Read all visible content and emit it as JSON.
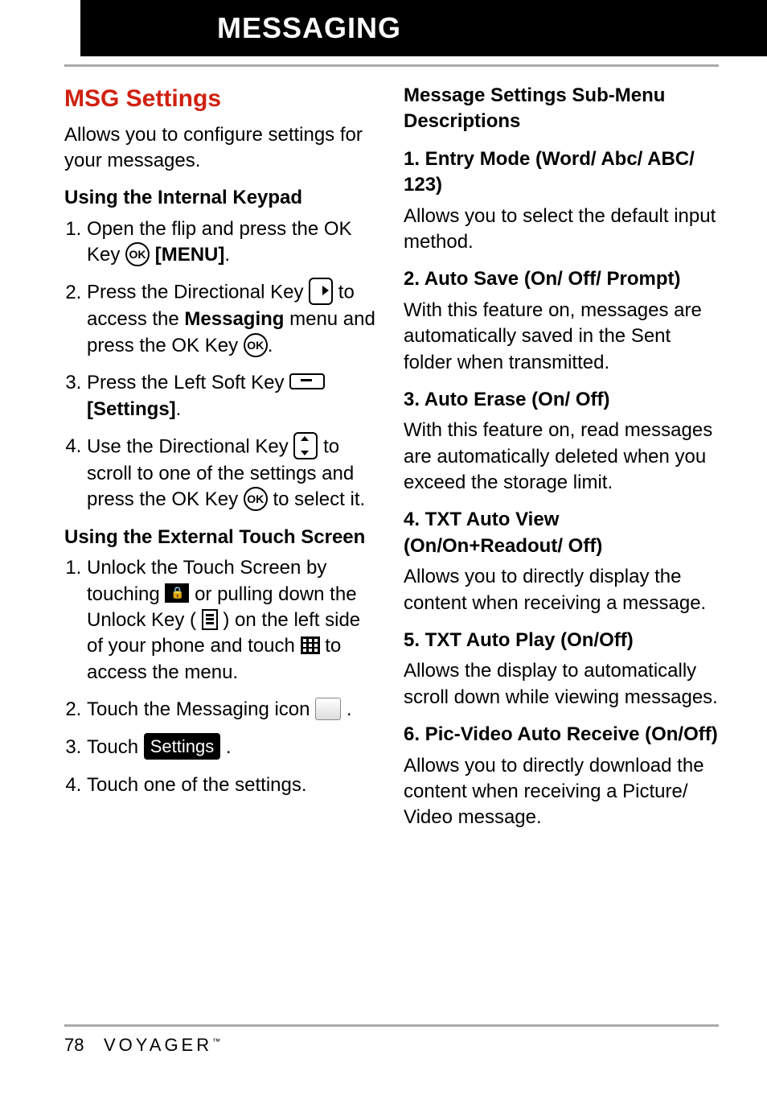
{
  "header": {
    "title": "MESSAGING"
  },
  "left": {
    "section_title": "MSG Settings",
    "intro": "Allows you to configure settings for your messages.",
    "keypad_heading": "Using the Internal Keypad",
    "kp1_a": "Open the flip and press the OK Key ",
    "kp1_b": " [MENU]",
    "kp1_c": ".",
    "kp2_a": "Press the Directional Key ",
    "kp2_b": " to access the ",
    "kp2_c": "Messaging",
    "kp2_d": " menu and press the OK Key ",
    "kp2_e": ".",
    "kp3_a": "Press the Left Soft Key ",
    "kp3_b": " ",
    "kp3_c": "[Settings]",
    "kp3_d": ".",
    "kp4_a": "Use the Directional Key ",
    "kp4_b": " to scroll to one of the settings and press the OK Key ",
    "kp4_c": " to select it.",
    "touch_heading": "Using the External Touch Screen",
    "t1_a": "Unlock the Touch Screen by touching ",
    "t1_b": " or pulling down the Unlock Key ( ",
    "t1_c": " ) on the left side of your phone and touch ",
    "t1_d": " to access the menu.",
    "t2_a": "Touch the Messaging icon ",
    "t2_b": " .",
    "t3_a": "Touch ",
    "t3_b": " .",
    "t4": "Touch one of the settings.",
    "settings_pill": "Settings"
  },
  "right": {
    "submenu_heading": "Message Settings Sub-Menu Descriptions",
    "s1_h": "1. Entry Mode (Word/ Abc/ ABC/ 123)",
    "s1_p": "Allows you to select the default input method.",
    "s2_h": "2. Auto Save (On/ Off/ Prompt)",
    "s2_p": "With this feature on, messages are automatically saved in the Sent folder when transmitted.",
    "s3_h": "3. Auto Erase (On/ Off)",
    "s3_p": "With this feature on, read messages are automatically deleted when you exceed the storage limit.",
    "s4_h": "4. TXT Auto View (On/On+Readout/ Off)",
    "s4_p": "Allows you to directly display the content when receiving a message.",
    "s5_h": "5. TXT Auto Play (On/Off)",
    "s5_p": "Allows the display to automatically scroll down while viewing messages.",
    "s6_h": "6. Pic-Video Auto Receive (On/Off)",
    "s6_p": "Allows you to directly download the content when receiving a Picture/ Video message."
  },
  "footer": {
    "page": "78",
    "brand": "VOYAGER",
    "tm": "™"
  }
}
